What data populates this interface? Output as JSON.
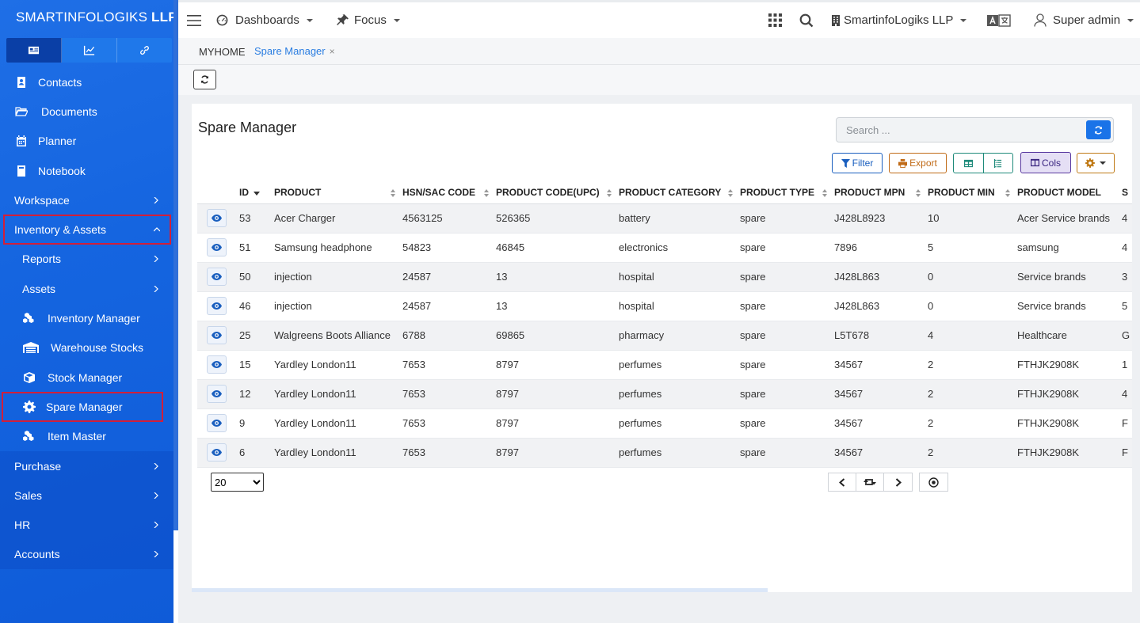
{
  "brand": {
    "name_light": "SMARTINFOLOGIKS",
    "name_bold": "LLP"
  },
  "sidebar": {
    "mode_tabs": [
      {
        "icon": "id-card-icon"
      },
      {
        "icon": "chart-line-icon"
      },
      {
        "icon": "link-icon"
      }
    ],
    "items": [
      {
        "label": "Contacts",
        "icon": "address-book-icon"
      },
      {
        "label": "Documents",
        "icon": "folder-open-icon"
      },
      {
        "label": "Planner",
        "icon": "calendar-icon"
      },
      {
        "label": "Notebook",
        "icon": "book-icon"
      },
      {
        "label": "Workspace"
      },
      {
        "label": "Inventory & Assets"
      },
      {
        "label": "Reports"
      },
      {
        "label": "Assets"
      },
      {
        "label": "Inventory Manager",
        "icon": "cubes-icon"
      },
      {
        "label": "Warehouse Stocks",
        "icon": "warehouse-icon"
      },
      {
        "label": "Stock Manager",
        "icon": "box-icon"
      },
      {
        "label": "Spare Manager",
        "icon": "gear-icon"
      },
      {
        "label": "Item Master",
        "icon": "cubes-icon"
      },
      {
        "label": "Purchase"
      },
      {
        "label": "Sales"
      },
      {
        "label": "HR"
      },
      {
        "label": "Accounts"
      }
    ]
  },
  "topbar": {
    "dashboards": "Dashboards",
    "focus": "Focus",
    "company": "SmartinfoLogiks LLP",
    "user": "Super admin"
  },
  "breadcrumb": {
    "home": "MYHOME",
    "tab": "Spare Manager",
    "close": "×"
  },
  "card": {
    "title": "Spare Manager",
    "search_placeholder": "Search ...",
    "buttons": {
      "filter": "Filter",
      "export": "Export",
      "cols": "Cols"
    }
  },
  "table": {
    "columns": [
      "ID",
      "PRODUCT",
      "HSN/SAC CODE",
      "PRODUCT CODE(UPC)",
      "PRODUCT CATEGORY",
      "PRODUCT TYPE",
      "PRODUCT MPN",
      "PRODUCT MIN",
      "PRODUCT MODEL",
      "S"
    ],
    "rows": [
      [
        "53",
        "Acer Charger",
        "4563125",
        "526365",
        "battery",
        "spare",
        "J428L8923",
        "10",
        "Acer Service brands",
        "4"
      ],
      [
        "51",
        "Samsung headphone",
        "54823",
        "46845",
        "electronics",
        "spare",
        "7896",
        "5",
        "samsung",
        "4"
      ],
      [
        "50",
        "injection",
        "24587",
        "13",
        "hospital",
        "spare",
        "J428L863",
        "0",
        "Service brands",
        "3"
      ],
      [
        "46",
        "injection",
        "24587",
        "13",
        "hospital",
        "spare",
        "J428L863",
        "0",
        "Service brands",
        "5"
      ],
      [
        "25",
        "Walgreens Boots Alliance",
        "6788",
        "69865",
        "pharmacy",
        "spare",
        "L5T678",
        "4",
        "Healthcare",
        "G"
      ],
      [
        "15",
        "Yardley London11",
        "7653",
        "8797",
        "perfumes",
        "spare",
        "34567",
        "2",
        "FTHJK2908K",
        "1"
      ],
      [
        "12",
        "Yardley London11",
        "7653",
        "8797",
        "perfumes",
        "spare",
        "34567",
        "2",
        "FTHJK2908K",
        "4"
      ],
      [
        "9",
        "Yardley London11",
        "7653",
        "8797",
        "perfumes",
        "spare",
        "34567",
        "2",
        "FTHJK2908K",
        "F"
      ],
      [
        "6",
        "Yardley London11",
        "7653",
        "8797",
        "perfumes",
        "spare",
        "34567",
        "2",
        "FTHJK2908K",
        "F"
      ]
    ]
  },
  "pagination": {
    "page_size": "20"
  },
  "colors": {
    "accent": "#1a73e8",
    "sidebar": "#1565e0",
    "highlight": "#d11f3a"
  }
}
